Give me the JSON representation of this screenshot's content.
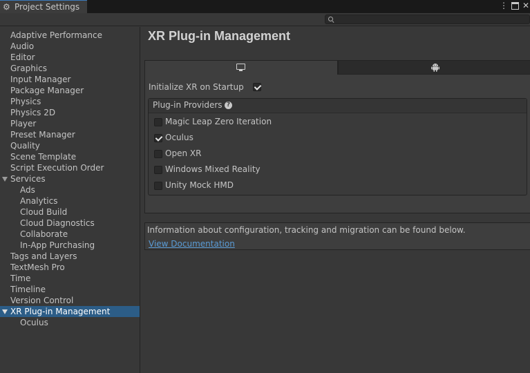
{
  "window": {
    "tab_title": "Project Settings",
    "menu_icon": "kebab-menu-icon",
    "maximize_icon": "maximize-icon",
    "close_icon": "close-icon",
    "search": {
      "value": "",
      "placeholder": ""
    }
  },
  "sidebar": {
    "items": [
      {
        "label": "Adaptive Performance"
      },
      {
        "label": "Audio"
      },
      {
        "label": "Editor"
      },
      {
        "label": "Graphics"
      },
      {
        "label": "Input Manager"
      },
      {
        "label": "Package Manager"
      },
      {
        "label": "Physics"
      },
      {
        "label": "Physics 2D"
      },
      {
        "label": "Player"
      },
      {
        "label": "Preset Manager"
      },
      {
        "label": "Quality"
      },
      {
        "label": "Scene Template"
      },
      {
        "label": "Script Execution Order"
      },
      {
        "label": "Services",
        "expanded": true
      },
      {
        "label": "Ads",
        "child": true
      },
      {
        "label": "Analytics",
        "child": true
      },
      {
        "label": "Cloud Build",
        "child": true
      },
      {
        "label": "Cloud Diagnostics",
        "child": true
      },
      {
        "label": "Collaborate",
        "child": true
      },
      {
        "label": "In-App Purchasing",
        "child": true
      },
      {
        "label": "Tags and Layers"
      },
      {
        "label": "TextMesh Pro"
      },
      {
        "label": "Time"
      },
      {
        "label": "Timeline"
      },
      {
        "label": "Version Control"
      },
      {
        "label": "XR Plug-in Management",
        "expanded": true,
        "selected": true
      },
      {
        "label": "Oculus",
        "child": true
      }
    ]
  },
  "main": {
    "title": "XR Plug-in Management",
    "platform_tabs": [
      {
        "icon": "monitor-icon",
        "active": true
      },
      {
        "icon": "android-icon",
        "active": false
      }
    ],
    "init_xr": {
      "label": "Initialize XR on Startup",
      "checked": true
    },
    "providers": {
      "title": "Plug-in Providers",
      "items": [
        {
          "label": "Magic Leap Zero Iteration",
          "checked": false
        },
        {
          "label": "Oculus",
          "checked": true
        },
        {
          "label": "Open XR",
          "checked": false
        },
        {
          "label": "Windows Mixed Reality",
          "checked": false
        },
        {
          "label": "Unity Mock HMD",
          "checked": false
        }
      ]
    },
    "info": {
      "text": "Information about configuration, tracking and migration can be found below.",
      "link": "View Documentation"
    }
  },
  "colors": {
    "selection": "#2c5d87",
    "link": "#5a9bd5",
    "background": "#383838"
  }
}
